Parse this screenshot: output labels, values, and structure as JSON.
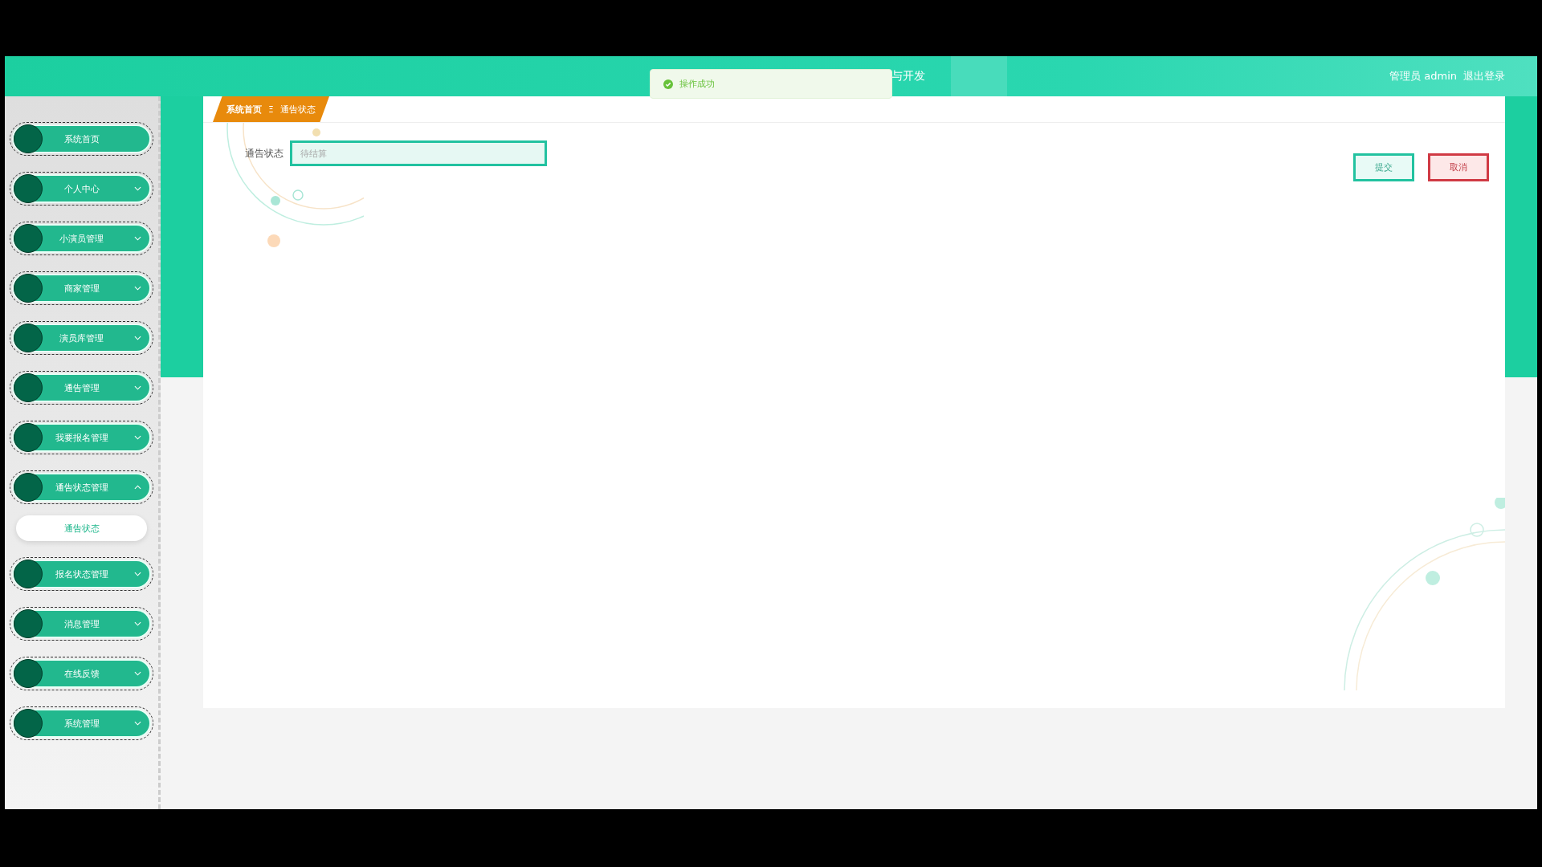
{
  "header": {
    "title": "与开发",
    "user": "管理员 admin",
    "logout": "退出登录"
  },
  "toast": {
    "kind": "success",
    "message": "操作成功"
  },
  "sidebar": {
    "items": [
      {
        "label": "系统首页",
        "kind": "link"
      },
      {
        "label": "个人中心",
        "kind": "group",
        "expanded": false
      },
      {
        "label": "小演员管理",
        "kind": "group",
        "expanded": false
      },
      {
        "label": "商家管理",
        "kind": "group",
        "expanded": false
      },
      {
        "label": "演员库管理",
        "kind": "group",
        "expanded": false
      },
      {
        "label": "通告管理",
        "kind": "group",
        "expanded": false
      },
      {
        "label": "我要报名管理",
        "kind": "group",
        "expanded": false
      },
      {
        "label": "通告状态管理",
        "kind": "group",
        "expanded": true,
        "children": [
          {
            "label": "通告状态",
            "selected": true
          }
        ]
      },
      {
        "label": "报名状态管理",
        "kind": "group",
        "expanded": false
      },
      {
        "label": "消息管理",
        "kind": "group",
        "expanded": false
      },
      {
        "label": "在线反馈",
        "kind": "group",
        "expanded": false
      },
      {
        "label": "系统管理",
        "kind": "group",
        "expanded": false
      }
    ]
  },
  "breadcrumb": [
    "系统首页",
    "通告状态"
  ],
  "breadcrumb_separator": "Ξ",
  "form": {
    "label": "通告状态",
    "placeholder": "待结算"
  },
  "buttons": [
    {
      "label": "提交",
      "kind": "primary"
    },
    {
      "label": "取消",
      "kind": "danger"
    }
  ]
}
